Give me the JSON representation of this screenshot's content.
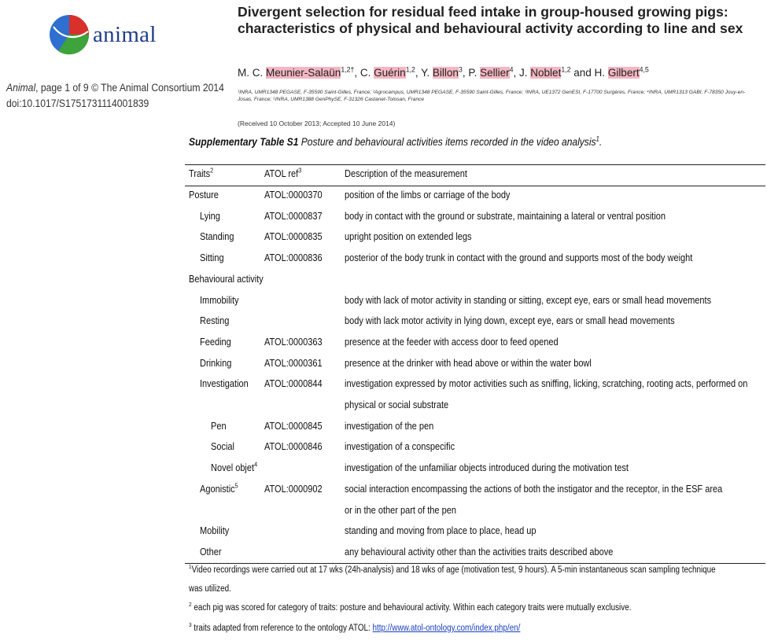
{
  "header": {
    "logo_word": "animal",
    "journal_name": "Animal",
    "journal_rest": ", page 1 of 9  © The Animal Consortium 2014",
    "doi": "doi:10.1017/S1751731114001839",
    "title": "Divergent selection for residual feed intake in group-housed growing pigs: characteristics of physical and behavioural activity according to line and sex",
    "authors": [
      {
        "name": "M. C. ",
        "hl": "Meunier-Salaün",
        "sup": "1,2†",
        "sep": ", "
      },
      {
        "name": "C. ",
        "hl": "Guérin",
        "sup": "1,2",
        "sep": ", "
      },
      {
        "name": "Y. ",
        "hl": "Billon",
        "sup": "3",
        "sep": ", "
      },
      {
        "name": "P. ",
        "hl": "Sellier",
        "sup": "4",
        "sep": ", "
      },
      {
        "name": "J. ",
        "hl": "Noblet",
        "sup": "1,2",
        "sep": " and "
      },
      {
        "name": "H. ",
        "hl": "Gilbert",
        "sup": "4,5",
        "sep": ""
      }
    ],
    "affiliations": "¹INRA, UMR1348 PEGASE, F-35590 Saint-Gilles, France; ²Agrocampus, UMR1348 PEGASE, F-35590 Saint-Gilles, France; ³INRA, UE1372 GenESI, F-17700 Surgères, France; ⁴INRA, UMR1313 GABI, F-78350 Jouy-en-Josas, France; ⁵INRA, UMR1388 GenPhySE, F-31326 Castanet-Tolosan, France",
    "received": "(Received 10 October 2013; Accepted 10 June 2014)"
  },
  "caption": {
    "label": "Supplementary Table S1",
    "text": " Posture and behavioural activities items recorded in the video analysis",
    "sup": "1",
    "end": "."
  },
  "table": {
    "headers": {
      "traits": "Traits",
      "traits_sup": "2",
      "atol": "ATOL ref",
      "atol_sup": "3",
      "desc": "Description of the measurement"
    },
    "rows": [
      {
        "trait": "Posture",
        "sup": "",
        "atol": "ATOL:0000370",
        "desc": "position of the limbs or carriage of the body"
      },
      {
        "trait": "Lying",
        "sup": "",
        "atol": "ATOL:0000837",
        "desc": "body in contact with the ground or substrate, maintaining a lateral or ventral position"
      },
      {
        "trait": "Standing",
        "sup": "",
        "atol": "ATOL:0000835",
        "desc": "upright position on extended legs"
      },
      {
        "trait": "Sitting",
        "sup": "",
        "atol": "ATOL:0000836",
        "desc": "posterior of the body trunk in contact with the ground and supports most of the body weight"
      },
      {
        "trait": "Behavioural activity",
        "sup": "",
        "atol": "",
        "desc": ""
      },
      {
        "trait": "Immobility",
        "sup": "",
        "atol": "",
        "desc": "body with lack of motor activity in standing or sitting, except eye, ears or small head movements"
      },
      {
        "trait": "Resting",
        "sup": "",
        "atol": "",
        "desc": "body with lack motor activity in lying down, except eye, ears or small head movements"
      },
      {
        "trait": "Feeding",
        "sup": "",
        "atol": "ATOL:0000363",
        "desc": "presence at the feeder with access door to feed opened"
      },
      {
        "trait": "Drinking",
        "sup": "",
        "atol": "ATOL:0000361",
        "desc": "presence at the drinker with head above or within the water bowl"
      },
      {
        "trait": "Investigation",
        "sup": "",
        "atol": "ATOL:0000844",
        "desc": "investigation expressed by motor activities such as sniffing, licking, scratching, rooting acts, performed on"
      },
      {
        "trait": "",
        "sup": "",
        "atol": "",
        "desc": "physical or social substrate"
      },
      {
        "trait": "Pen",
        "sup": "",
        "atol": "ATOL:0000845",
        "desc": "investigation of the pen"
      },
      {
        "trait": "Social",
        "sup": "",
        "atol": "ATOL:0000846",
        "desc": "investigation of a conspecific"
      },
      {
        "trait": "Novel objet",
        "sup": "4",
        "atol": "",
        "desc": "investigation of the unfamiliar objects introduced during the motivation test"
      },
      {
        "trait": "Agonistic",
        "sup": "5",
        "atol": "ATOL:0000902",
        "desc": "social interaction encompassing the actions of both the instigator and the receptor, in the ESF area"
      },
      {
        "trait": "",
        "sup": "",
        "atol": "",
        "desc": "or in the other part of the pen"
      },
      {
        "trait": "Mobility",
        "sup": "",
        "atol": "",
        "desc": "standing and moving from place to place, head up"
      },
      {
        "trait": "Other",
        "sup": "",
        "atol": "",
        "desc": "any behavioural activity other than the activities traits described above"
      }
    ]
  },
  "footnotes": {
    "fn1_sup": "1",
    "fn1_line1": "Video recordings were carried out at 17 wks (24h-analysis) and 18 wks of age (motivation test, 9 hours). A 5-min instantaneous scan sampling technique",
    "fn1_line2": "was utilized.",
    "fn2_sup": "2",
    "fn2": " each pig was scored for category of traits: posture and behavioural activity. Within each category traits were mutually exclusive.",
    "fn3_sup": "3",
    "fn3": " traits adapted from reference to the ontology ATOL: ",
    "fn3_link": "http://www.atol-ontology.com/index.php/en/"
  },
  "colors": {
    "logo_blue": "#2f6fd0",
    "logo_red": "#d8302a",
    "logo_green": "#3da33a",
    "highlight": "#f4b6c2",
    "link": "#1a3fbf"
  }
}
